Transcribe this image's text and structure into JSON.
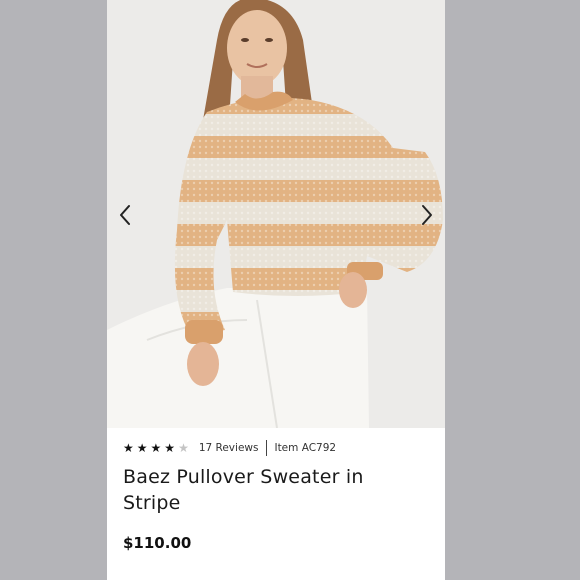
{
  "product": {
    "image_alt": "Model wearing striped pullover sweater",
    "rating": {
      "filled_stars": 4,
      "total_stars": 5,
      "reviews_label": "17 Reviews"
    },
    "item_label": "Item AC792",
    "title": "Baez Pullover Sweater in Stripe",
    "price": "$110.00"
  },
  "gallery": {
    "prev_icon": "chevron-left-icon",
    "next_icon": "chevron-right-icon"
  },
  "colors": {
    "page_background": "#b4b4b8",
    "stripe_orange": "#e2b383",
    "stripe_cream": "#e9e3d8",
    "pants_white": "#f7f6f3"
  }
}
